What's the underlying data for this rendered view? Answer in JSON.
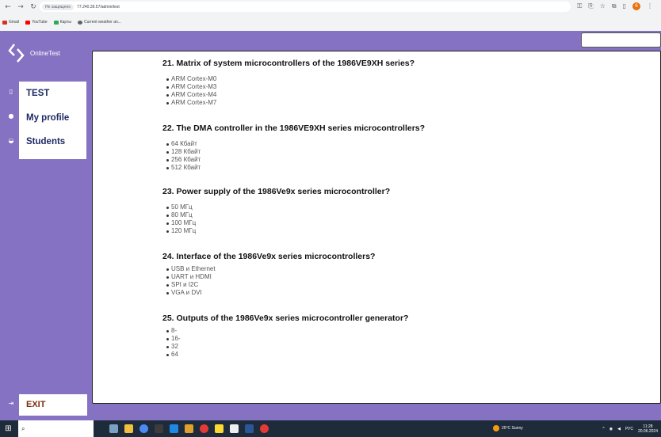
{
  "browser": {
    "security_label": "Не защищено",
    "url": "77.240.39.57/admin/test",
    "bookmarks": [
      {
        "label": "Gmail",
        "color": "#d93025"
      },
      {
        "label": "YouTube",
        "color": "#ff0000"
      },
      {
        "label": "Карты",
        "color": "#34a853"
      },
      {
        "label": "Current weather an...",
        "color": "#5f6368"
      }
    ],
    "profile_initial": "6"
  },
  "app": {
    "logo_text": "OnlineTest",
    "menu": [
      {
        "label": "TEST"
      },
      {
        "label": "My profile"
      },
      {
        "label": "Students"
      }
    ],
    "exit_label": "EXIT"
  },
  "questions": [
    {
      "title": "21. Matrix of system microcontrollers of the 1986VE9XH series?",
      "options": [
        "ARM Cortex-M0",
        "ARM Cortex-M3",
        "ARM Cortex-M4",
        "ARM Cortex-M7"
      ]
    },
    {
      "title": "22. The DMA controller in the 1986VE9XH series microcontrollers?",
      "options": [
        "64 Кбайт",
        "128 Кбайт",
        "256 Кбайт",
        "512 Кбайт"
      ]
    },
    {
      "title": "23. Power supply of the 1986Ve9x series microcontroller?",
      "options": [
        "50 МГц",
        "80 МГц",
        "100 МГц",
        "120 МГц"
      ]
    },
    {
      "title": "24. Interface of the 1986Ve9x series microcontrollers?",
      "options": [
        "USB и Ethernet",
        "UART и HDMI",
        "SPI и I2C",
        "VGA и DVI"
      ]
    },
    {
      "title": "25. Outputs of the 1986Ve9x series microcontroller generator?",
      "options": [
        "8-",
        "16-",
        "32",
        "64"
      ]
    }
  ],
  "taskbar": {
    "weather": "25°C  Sunny",
    "lang": "РУС",
    "time": "11:28",
    "date": "20.06.2024"
  }
}
